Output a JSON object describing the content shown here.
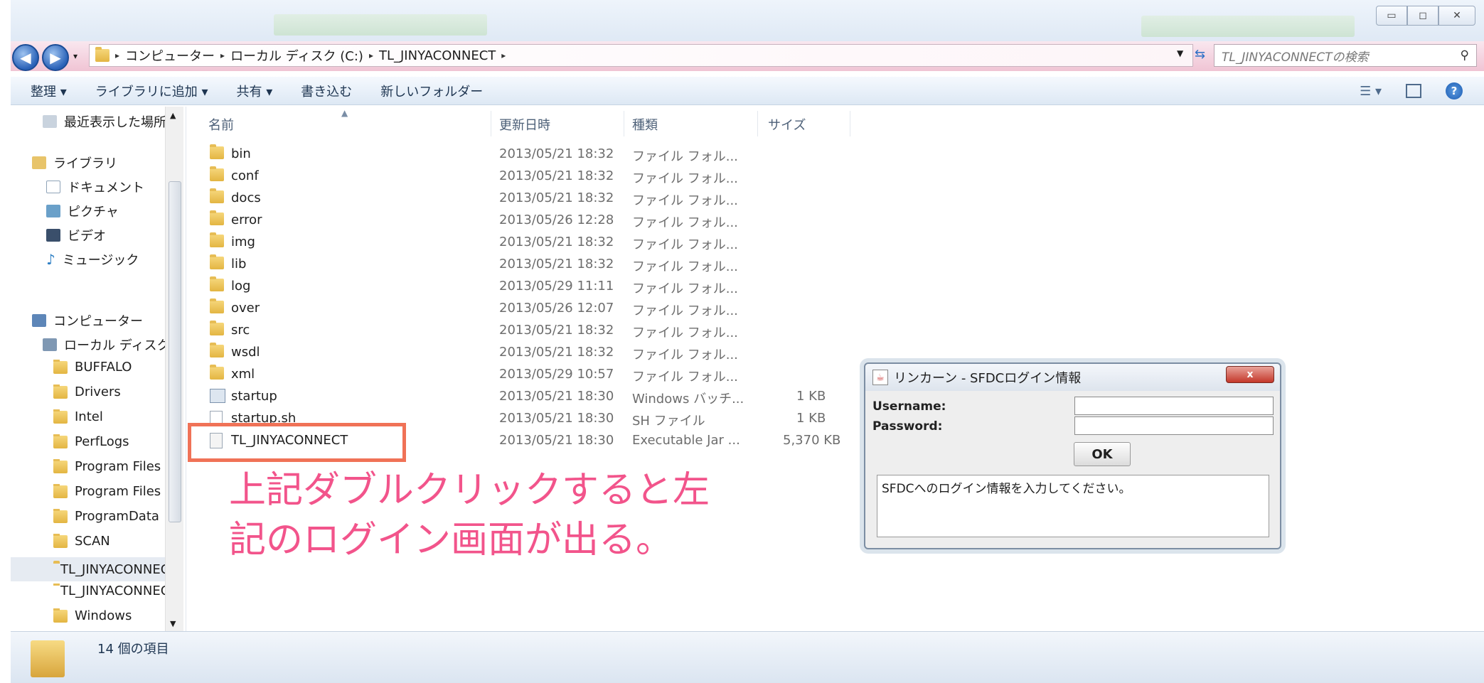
{
  "window": {
    "controls": [
      "▭",
      "◻",
      "✕"
    ]
  },
  "address": {
    "crumbs": [
      "コンピューター",
      "ローカル ディスク (C:)",
      "TL_JINYACONNECT"
    ],
    "search_placeholder": "TL_JINYACONNECTの検索"
  },
  "toolbar": {
    "organize": "整理 ▾",
    "add_to_library": "ライブラリに追加 ▾",
    "share": "共有 ▾",
    "burn": "書き込む",
    "new_folder": "新しいフォルダー"
  },
  "nav": {
    "recent": "最近表示した場所",
    "libraries": "ライブラリ",
    "documents": "ドキュメント",
    "pictures": "ピクチャ",
    "videos": "ビデオ",
    "music": "ミュージック",
    "computer": "コンピューター",
    "local_disk": "ローカル ディスク",
    "folders": [
      "BUFFALO",
      "Drivers",
      "Intel",
      "PerfLogs",
      "Program Files",
      "Program Files",
      "ProgramData",
      "SCAN",
      "TL_JINYACONNECT",
      "TL_JINYACONNECT",
      "Windows"
    ]
  },
  "columns": {
    "name": "名前",
    "date": "更新日時",
    "type": "種類",
    "size": "サイズ"
  },
  "files": [
    {
      "name": "bin",
      "date": "2013/05/21 18:32",
      "type": "ファイル フォル...",
      "size": ""
    },
    {
      "name": "conf",
      "date": "2013/05/21 18:32",
      "type": "ファイル フォル...",
      "size": ""
    },
    {
      "name": "docs",
      "date": "2013/05/21 18:32",
      "type": "ファイル フォル...",
      "size": ""
    },
    {
      "name": "error",
      "date": "2013/05/26 12:28",
      "type": "ファイル フォル...",
      "size": ""
    },
    {
      "name": "img",
      "date": "2013/05/21 18:32",
      "type": "ファイル フォル...",
      "size": ""
    },
    {
      "name": "lib",
      "date": "2013/05/21 18:32",
      "type": "ファイル フォル...",
      "size": ""
    },
    {
      "name": "log",
      "date": "2013/05/29 11:11",
      "type": "ファイル フォル...",
      "size": ""
    },
    {
      "name": "over",
      "date": "2013/05/26 12:07",
      "type": "ファイル フォル...",
      "size": ""
    },
    {
      "name": "src",
      "date": "2013/05/21 18:32",
      "type": "ファイル フォル...",
      "size": ""
    },
    {
      "name": "wsdl",
      "date": "2013/05/21 18:32",
      "type": "ファイル フォル...",
      "size": ""
    },
    {
      "name": "xml",
      "date": "2013/05/29 10:57",
      "type": "ファイル フォル...",
      "size": ""
    },
    {
      "name": "startup",
      "date": "2013/05/21 18:30",
      "type": "Windows バッチ...",
      "size": "1 KB"
    },
    {
      "name": "startup.sh",
      "date": "2013/05/21 18:30",
      "type": "SH ファイル",
      "size": "1 KB"
    },
    {
      "name": "TL_JINYACONNECT",
      "date": "2013/05/21 18:30",
      "type": "Executable Jar ...",
      "size": "5,370 KB"
    }
  ],
  "annotation": {
    "line1": "上記ダブルクリックすると左",
    "line2": "記のログイン画面が出る。"
  },
  "dialog": {
    "title": "リンカーン - SFDCログイン情報",
    "close": "x",
    "username_label": "Username:",
    "password_label": "Password:",
    "ok": "OK",
    "message": "SFDCへのログイン情報を入力してください。"
  },
  "status": {
    "count": "14 個の項目"
  }
}
